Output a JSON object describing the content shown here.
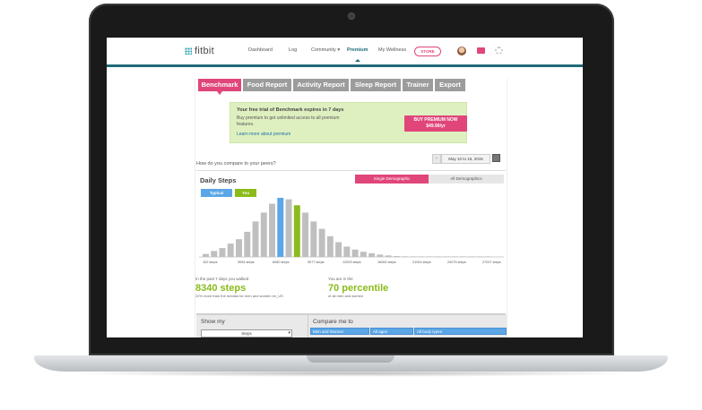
{
  "nav": {
    "logo": "fitbit",
    "items": [
      "Dashboard",
      "Log",
      "Community",
      "Premium",
      "My Wellness"
    ],
    "store": "STORE"
  },
  "tabs": [
    "Benchmark",
    "Food Report",
    "Activity Report",
    "Sleep Report",
    "Trainer",
    "Export"
  ],
  "trial": {
    "title": "Your free trial of Benchmark expires in 7 days",
    "body": "Buy premium to get unlimited access to all premium features.",
    "link": "Learn more about premium",
    "buy_line1": "BUY PREMIUM NOW",
    "buy_line2": "$49.99/yr"
  },
  "question": "How do you compare to your peers?",
  "date_range": "May 10 to 16, 2015",
  "chart_panel": {
    "title": "Daily Steps",
    "seg_single": "Single Demographic",
    "seg_all": "All Demographics",
    "legend_typical": "Typical",
    "legend_you": "You"
  },
  "chart_data": {
    "type": "bar",
    "title": "Daily Steps",
    "x_tick_labels": [
      "102 steps",
      "3054 steps",
      "6080 steps",
      "9077 steps",
      "12003 steps",
      "16062 steps",
      "21044 steps",
      "24075 steps",
      "27027 steps"
    ],
    "values": [
      2,
      4,
      6,
      9,
      12,
      17,
      24,
      30,
      36,
      40,
      39,
      35,
      30,
      24,
      19,
      14,
      10,
      7,
      5,
      3.5,
      2.5,
      1.6,
      1,
      0.6,
      0.4,
      0.3,
      0.2,
      0.2,
      0.15,
      0.1,
      0.1,
      0.1,
      0.1,
      0.1,
      0.1
    ],
    "highlight_typical_index": 9,
    "highlight_you_index": 11,
    "colors": {
      "default": "#bfbfbf",
      "typical": "#5aa6e6",
      "you": "#8bbb1b"
    }
  },
  "stats": {
    "left_pre": "In the past 7 days you walked",
    "left_value": "8340 steps",
    "left_sub": "22% more than the median for men and women en_US",
    "right_pre": "You are in the",
    "right_value": "70 percentile",
    "right_sub": "of all men and women"
  },
  "bottom": {
    "show_my": "Show my",
    "select_value": "Steps",
    "compare_me_to": "Compare me to",
    "chips": [
      "Men and Women",
      "All ages",
      "All body types"
    ]
  },
  "colors": {
    "accent": "#e0467a",
    "teal": "#1f6a78",
    "green": "#8bbb1b",
    "blue": "#5aa6e6"
  }
}
